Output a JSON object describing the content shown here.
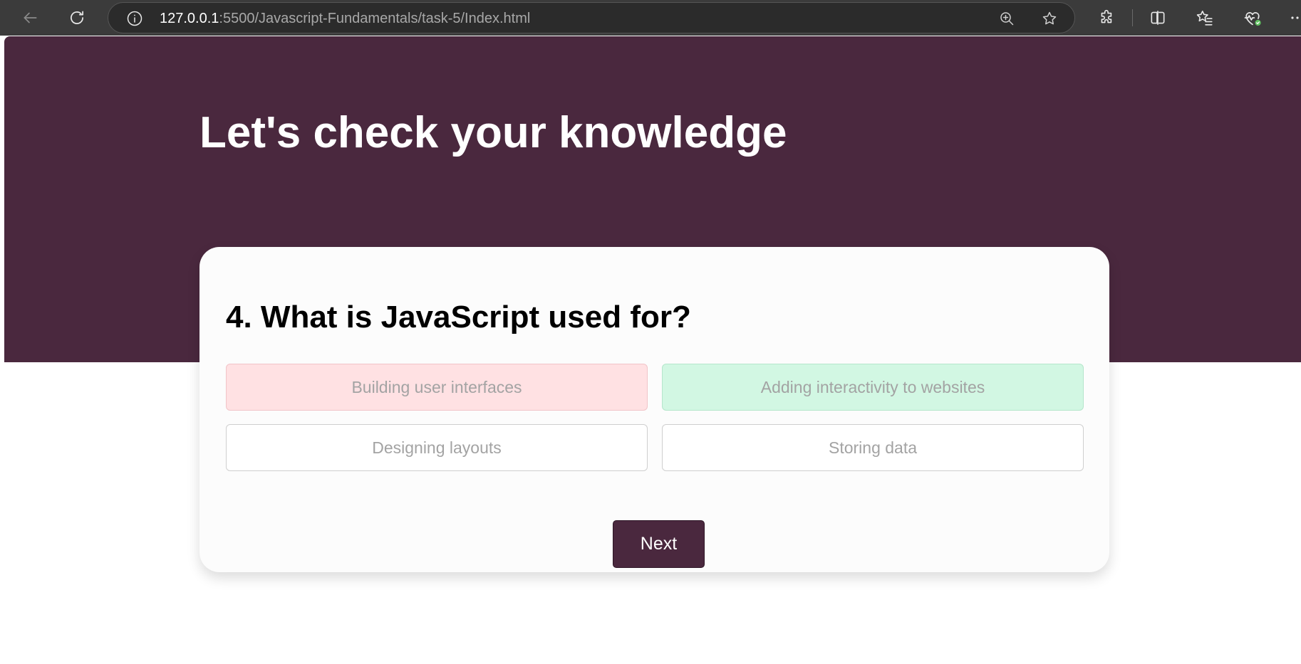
{
  "browser": {
    "url_host": "127.0.0.1",
    "url_rest": ":5500/Javascript-Fundamentals/task-5/Index.html",
    "icons": {
      "back": "back-arrow-icon",
      "reload": "reload-icon",
      "site_info": "info-icon",
      "zoom": "zoom-in-icon",
      "favorite": "star-icon",
      "extensions": "puzzle-icon",
      "split_screen": "split-screen-icon",
      "favorites_list": "favorites-icon",
      "browser_essentials": "heart-pulse-icon",
      "more": "more-icon"
    }
  },
  "page": {
    "title": "Let's check your knowledge",
    "colors": {
      "brand": "#4a283e",
      "wrong": "#ffe1e3",
      "correct": "#d2f7e3"
    }
  },
  "quiz": {
    "question": "4. What is JavaScript used for?",
    "answers": [
      {
        "label": "Building user interfaces",
        "state": "wrong"
      },
      {
        "label": "Adding interactivity to websites",
        "state": "correct"
      },
      {
        "label": "Designing layouts",
        "state": "neutral"
      },
      {
        "label": "Storing data",
        "state": "neutral"
      }
    ],
    "next_label": "Next"
  }
}
